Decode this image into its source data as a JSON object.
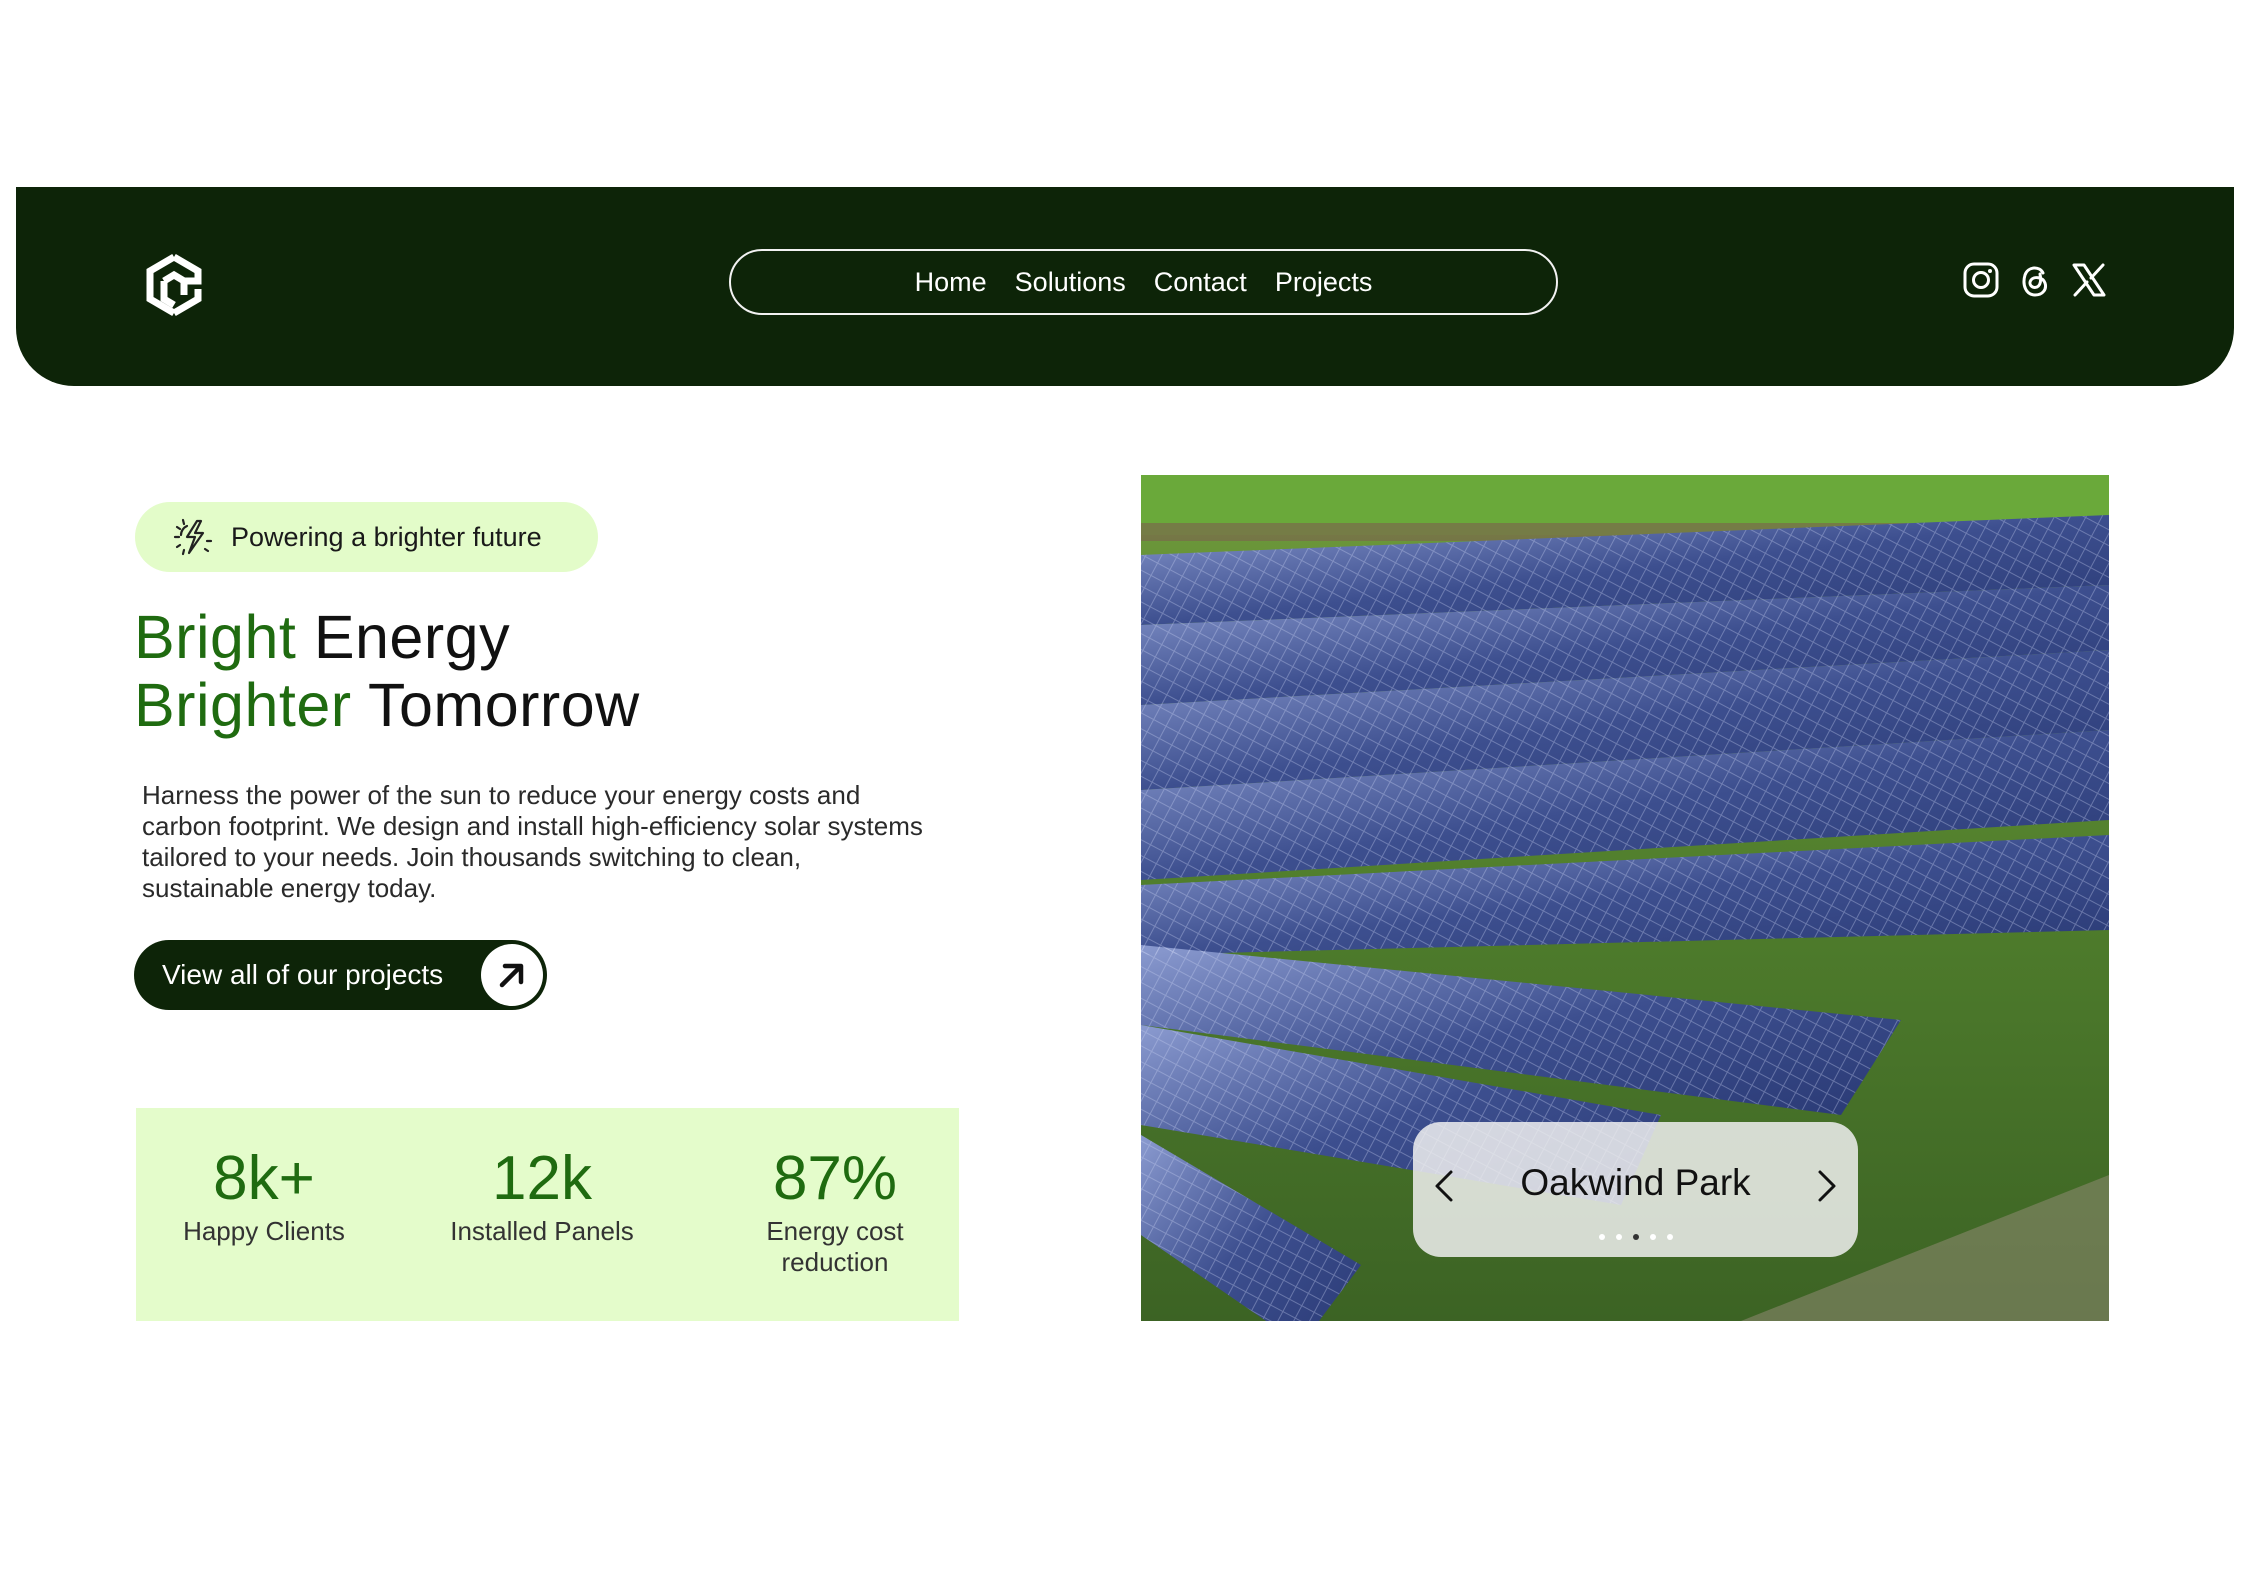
{
  "nav": {
    "items": [
      "Home",
      "Solutions",
      "Contact",
      "Projects"
    ]
  },
  "social": {
    "icons": [
      "instagram-icon",
      "threads-icon",
      "x-icon"
    ]
  },
  "hero": {
    "badge": "Powering a brighter future",
    "headline_line1_accent": "Bright",
    "headline_line1_rest": "Energy",
    "headline_line2_accent": "Brighter",
    "headline_line2_rest": "Tomorrow",
    "description": "Harness the power of the sun to reduce your energy costs and carbon footprint. We design and install high-efficiency solar systems tailored to your needs. Join thousands switching to clean, sustainable energy today.",
    "cta_label": "View all of our projects"
  },
  "stats": [
    {
      "value": "8k+",
      "label": "Happy Clients"
    },
    {
      "value": "12k",
      "label": "Installed Panels"
    },
    {
      "value": "87%",
      "label": "Energy cost reduction"
    }
  ],
  "carousel": {
    "title": "Oakwind Park",
    "dot_count": 5,
    "active_dot": 3
  },
  "colors": {
    "header_bg": "#0d2408",
    "accent_green": "#1f6b10",
    "light_green": "#e4fccb"
  }
}
